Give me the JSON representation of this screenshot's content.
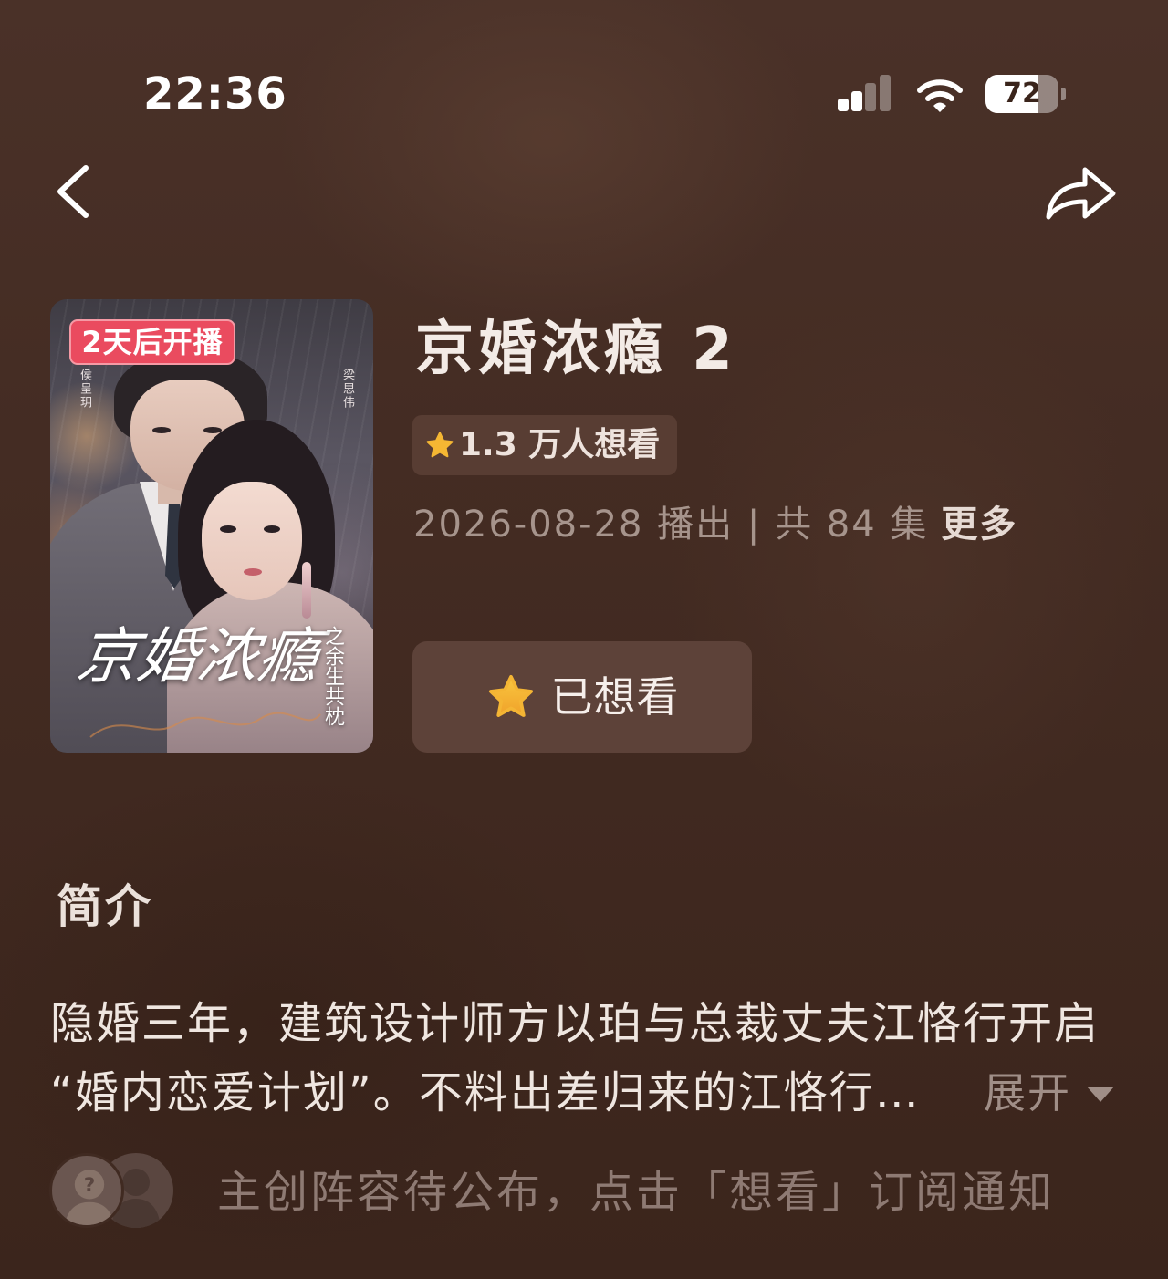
{
  "status_bar": {
    "time": "22:36",
    "battery_level": 72,
    "battery_label": "72",
    "signal_strength": 2,
    "signal_max": 4,
    "icons": {
      "signal": "cellular-signal-icon",
      "wifi": "wifi-icon",
      "battery": "battery-icon"
    }
  },
  "nav": {
    "back_icon": "chevron-left-icon",
    "share_icon": "share-icon"
  },
  "poster": {
    "badge": "2天后开播",
    "art_title": "京婚浓瘾",
    "art_subtitle": "之余生共枕",
    "actor_left": "侯呈玥",
    "actor_right": "梁思伟"
  },
  "show": {
    "title": "京婚浓瘾 2",
    "want_count": "1.3 万人想看",
    "release_info": "2026-08-28 播出 | 共 84 集",
    "more_label": "更多"
  },
  "want_button": {
    "label": "已想看",
    "icon": "star-icon"
  },
  "intro": {
    "heading": "简介",
    "lines": [
      "隐婚三年，建筑设计师方以珀与总裁丈夫江恪行开启",
      "“婚内恋爱计划”。不料出差归来的江恪行…"
    ],
    "expand_label": "展开",
    "expand_icon": "caret-down-icon"
  },
  "cast": {
    "notice": "主创阵容待公布，点击「想看」订阅通知",
    "avatar_icon": "person-placeholder-icon"
  },
  "colors": {
    "background": "#412a21",
    "badge": "#ea4b5f",
    "star": "#f5b733",
    "button_bg": "#5d4239",
    "signal_active": "#ffffff",
    "signal_inactive": "rgba(255,255,255,0.35)"
  }
}
